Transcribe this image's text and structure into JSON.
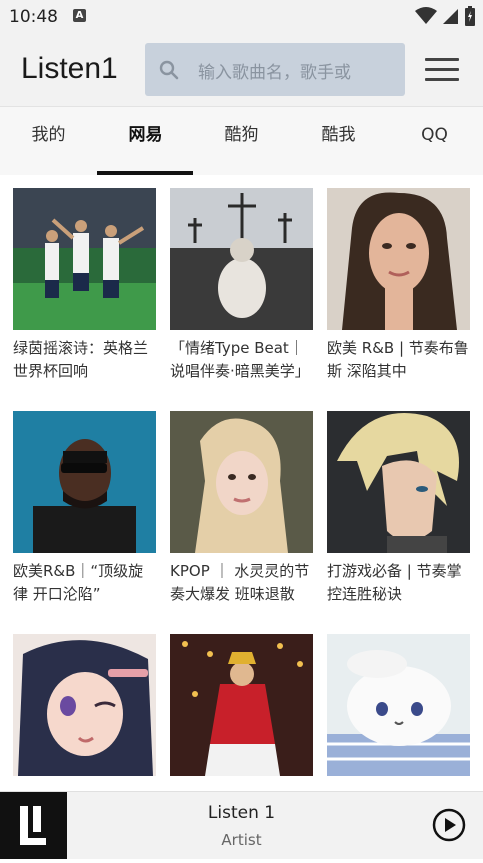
{
  "status": {
    "time": "10:48",
    "notif_letter": "A"
  },
  "appbar": {
    "title": "Listen1",
    "search_placeholder": "输入歌曲名，歌手或"
  },
  "tabs": [
    {
      "label": "我的",
      "active": false
    },
    {
      "label": "网易",
      "active": true
    },
    {
      "label": "酷狗",
      "active": false
    },
    {
      "label": "酷我",
      "active": false
    },
    {
      "label": "QQ",
      "active": false
    }
  ],
  "playlists": [
    {
      "caption": "绿茵摇滚诗：英格兰世界杯回响"
    },
    {
      "caption": "「情绪Type Beat｜说唱伴奏·暗黑美学」"
    },
    {
      "caption": "欧美 R&B | 节奏布鲁斯 深陷其中"
    },
    {
      "caption": "欧美R&B｜“顶级旋律 开口沦陷”"
    },
    {
      "caption": "KPOP ｜ 水灵灵的节奏大爆发 班味退散"
    },
    {
      "caption": "打游戏必备 | 节奏掌控连胜秘诀"
    },
    {
      "caption": ""
    },
    {
      "caption": ""
    },
    {
      "caption": ""
    }
  ],
  "player": {
    "title": "Listen 1",
    "artist": "Artist"
  }
}
